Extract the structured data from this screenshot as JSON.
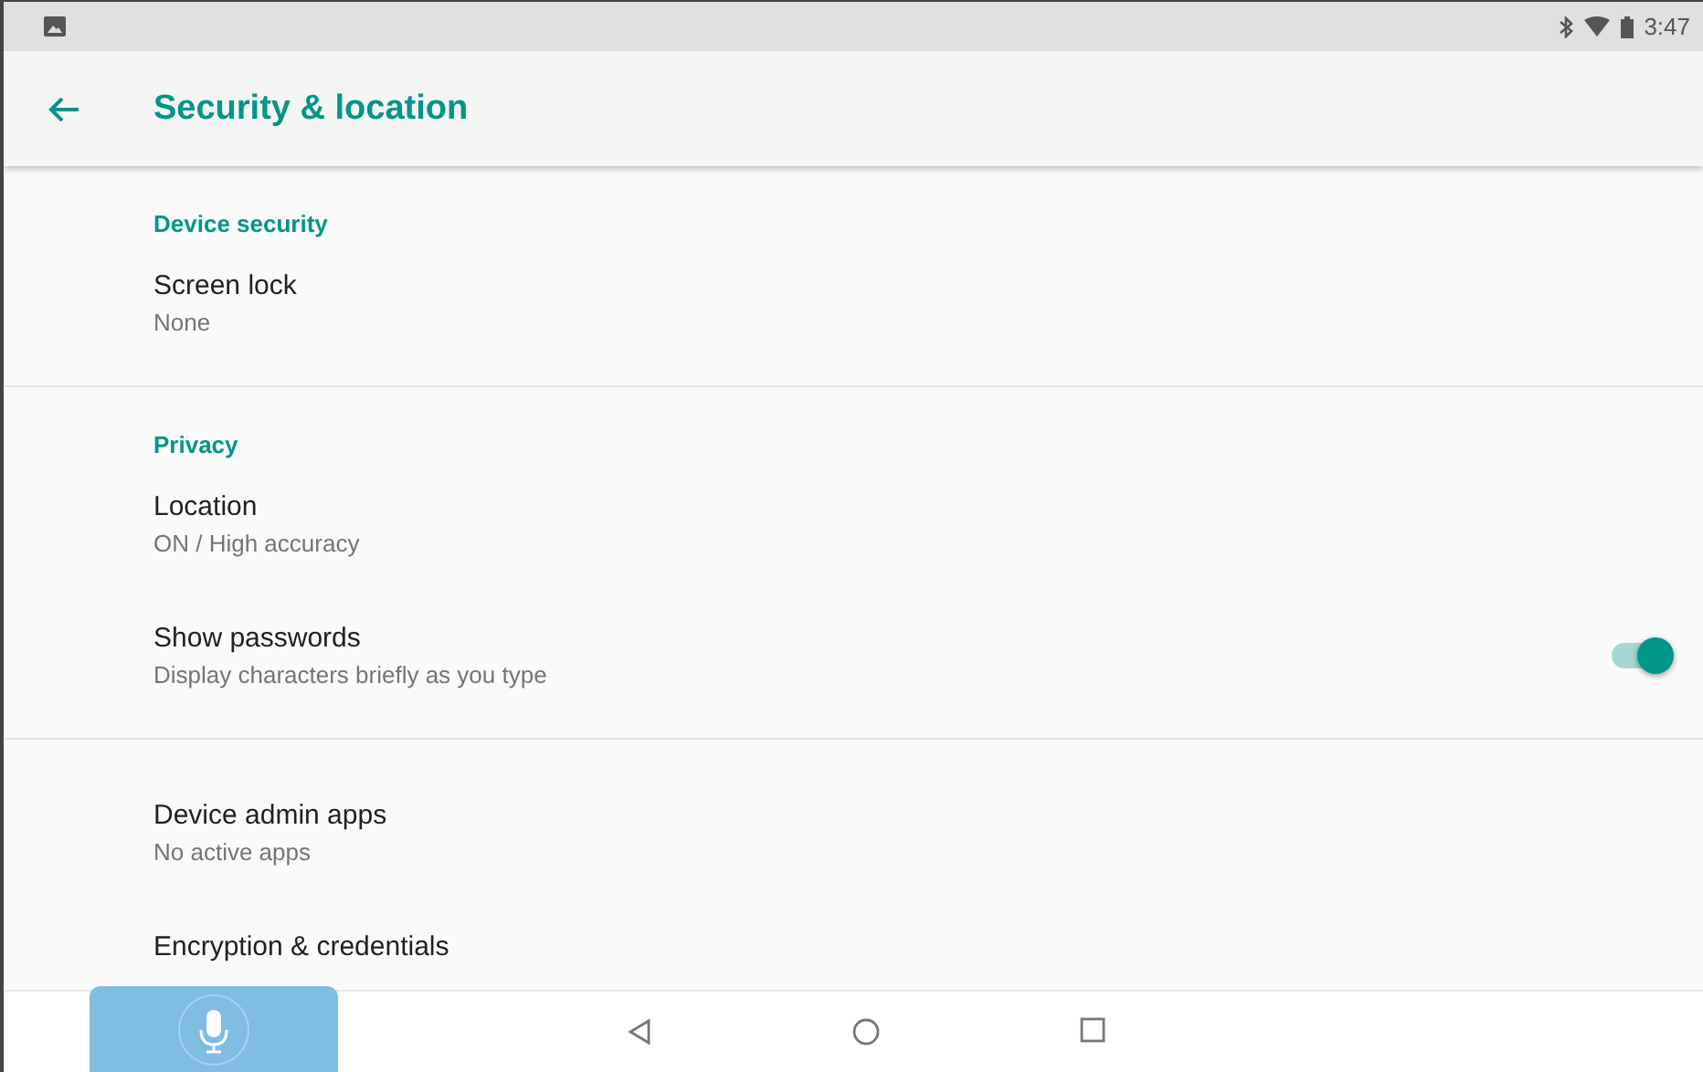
{
  "status_bar": {
    "time": "3:47"
  },
  "toolbar": {
    "title": "Security & location"
  },
  "items": [
    {
      "kind": "header",
      "title": "Device security"
    },
    {
      "kind": "item",
      "title": "Screen lock",
      "summary": "None"
    },
    {
      "kind": "divider"
    },
    {
      "kind": "header",
      "title": "Privacy"
    },
    {
      "kind": "item",
      "title": "Location",
      "summary": "ON / High accuracy"
    },
    {
      "kind": "switch",
      "title": "Show passwords",
      "summary": "Display characters briefly as you type",
      "on": true
    },
    {
      "kind": "divider"
    },
    {
      "kind": "item",
      "title": "Device admin apps",
      "summary": "No active apps"
    },
    {
      "kind": "item",
      "title": "Encryption & credentials"
    }
  ]
}
